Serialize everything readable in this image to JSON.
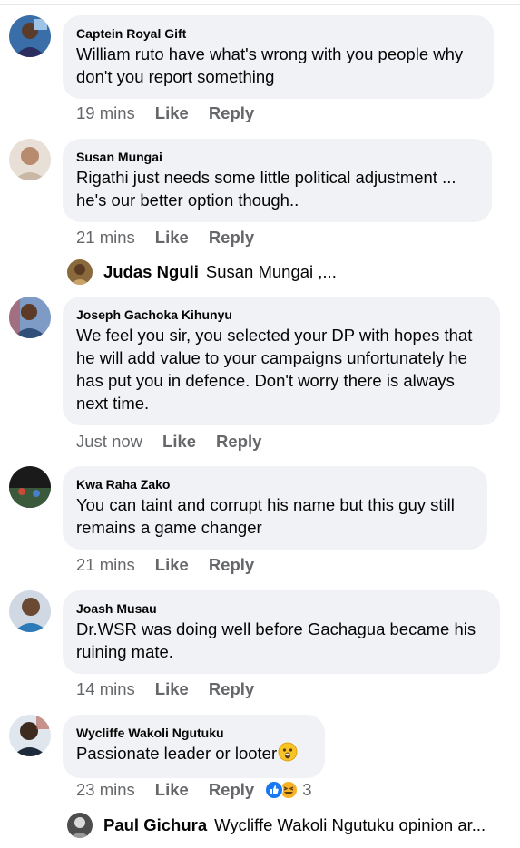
{
  "comments": [
    {
      "author": "Captein Royal Gift",
      "text": "William ruto have what's wrong with you people why\ndon't you report something",
      "time": "19 mins",
      "like": "Like",
      "reply": "Reply"
    },
    {
      "author": "Susan Mungai",
      "text": "Rigathi just needs some little political adjustment ...\nhe's our better option though..",
      "time": "21 mins",
      "like": "Like",
      "reply": "Reply",
      "reply_preview": {
        "name": "Judas Nguli",
        "text": "Susan Mungai ,..."
      }
    },
    {
      "author": "Joseph Gachoka Kihunyu",
      "text": "We feel you sir, you selected your DP with hopes that\nhe will add value to your campaigns unfortunately he\nhas put you in defence. Don't worry there is always\nnext time.",
      "time": "Just now",
      "like": "Like",
      "reply": "Reply"
    },
    {
      "author": "Kwa Raha Zako",
      "text": "You can taint and corrupt his name but this guy still\nremains a game changer",
      "time": "21 mins",
      "like": "Like",
      "reply": "Reply"
    },
    {
      "author": "Joash Musau",
      "text": "Dr.WSR was doing well before Gachagua became his\nruining mate.",
      "time": "14 mins",
      "like": "Like",
      "reply": "Reply"
    },
    {
      "author": "Wycliffe Wakoli Ngutuku",
      "text": "Passionate leader or looter",
      "time": "23 mins",
      "like": "Like",
      "reply": "Reply",
      "reaction_count": "3",
      "reply_preview": {
        "name": "Paul Gichura",
        "text": "Wycliffe Wakoli Ngutuku opinion ar..."
      }
    }
  ],
  "colors": {
    "bubble": "#f0f2f5",
    "meta": "#65676b",
    "text": "#050505",
    "like_blue": "#1877f2",
    "haha_yellow": "#f7b125"
  },
  "icons": {
    "reaction_like": "thumbs-up-icon",
    "reaction_haha": "laughing-face-icon",
    "emoji_in_text": "astonished-face-icon"
  }
}
